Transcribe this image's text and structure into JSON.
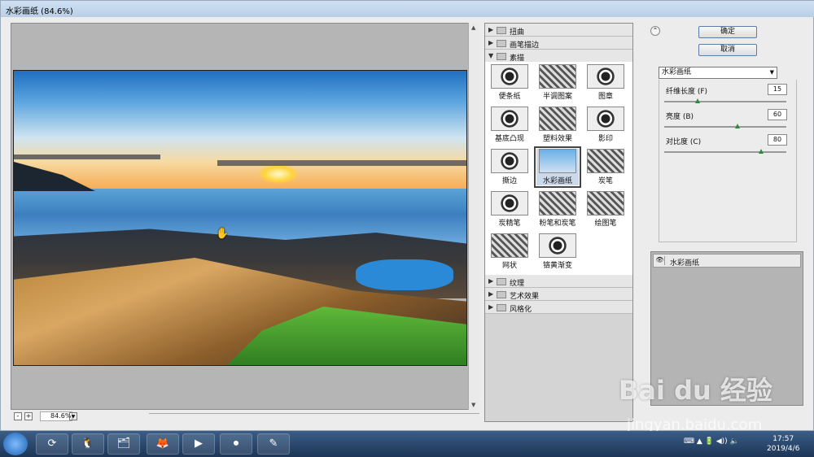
{
  "window": {
    "title": "水彩画纸 (84.6%)"
  },
  "preview": {
    "zoom": "84.6%",
    "zoom_minus": "-",
    "zoom_plus": "+"
  },
  "gallery": {
    "categories_top": [
      "扭曲",
      "画笔描边",
      "素描"
    ],
    "thumbs": [
      "便条纸",
      "半调图案",
      "图章",
      "基底凸现",
      "塑料效果",
      "影印",
      "撕边",
      "水彩画纸",
      "炭笔",
      "炭精笔",
      "粉笔和炭笔",
      "绘图笔",
      "网状",
      "铬黄渐变"
    ],
    "selected": "水彩画纸",
    "categories_bottom": [
      "纹理",
      "艺术效果",
      "风格化"
    ]
  },
  "panel": {
    "ok": "确定",
    "cancel": "取消",
    "filter_select": "水彩画纸",
    "params": [
      {
        "label": "纤维长度 (F)",
        "value": "15"
      },
      {
        "label": "亮度 (B)",
        "value": "60"
      },
      {
        "label": "对比度 (C)",
        "value": "80"
      }
    ],
    "layer_name": "水彩画纸"
  },
  "taskbar": {
    "time": "17:57",
    "date": "2019/4/6"
  },
  "watermark": {
    "line1": "Bai du 经验",
    "line2": "jingyan.baidu.com"
  }
}
